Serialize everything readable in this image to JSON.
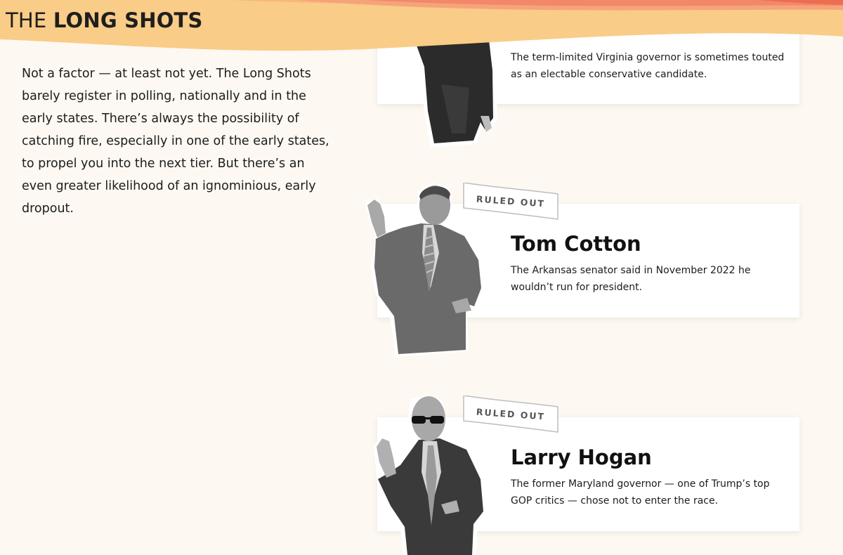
{
  "header": {
    "title_light": "THE ",
    "title_bold": "LONG SHOTS"
  },
  "intro": {
    "text": "Not a factor — at least not yet. The Long Shots barely register in polling, nationally and in the early states. There’s always the possibility of catching fire, especially in one of the early states, to propel you into the next tier. But there’s an even greater likelihood of an ignominious, early dropout."
  },
  "candidates": [
    {
      "name": "",
      "description": "The term-limited Virginia governor is sometimes touted as an electable conservative candidate.",
      "badge": ""
    },
    {
      "name": "Tom Cotton",
      "description": "The Arkansas senator said in November 2022 he wouldn’t run for president.",
      "badge": "RULED OUT"
    },
    {
      "name": "Larry Hogan",
      "description": "The former Maryland governor — one of Trump’s top GOP critics — chose not to enter the race.",
      "badge": "RULED OUT"
    }
  ],
  "colors": {
    "background": "#fdf8f1",
    "header_band": "#f9cc87",
    "header_accent": "#f0765a",
    "card": "#ffffff"
  }
}
